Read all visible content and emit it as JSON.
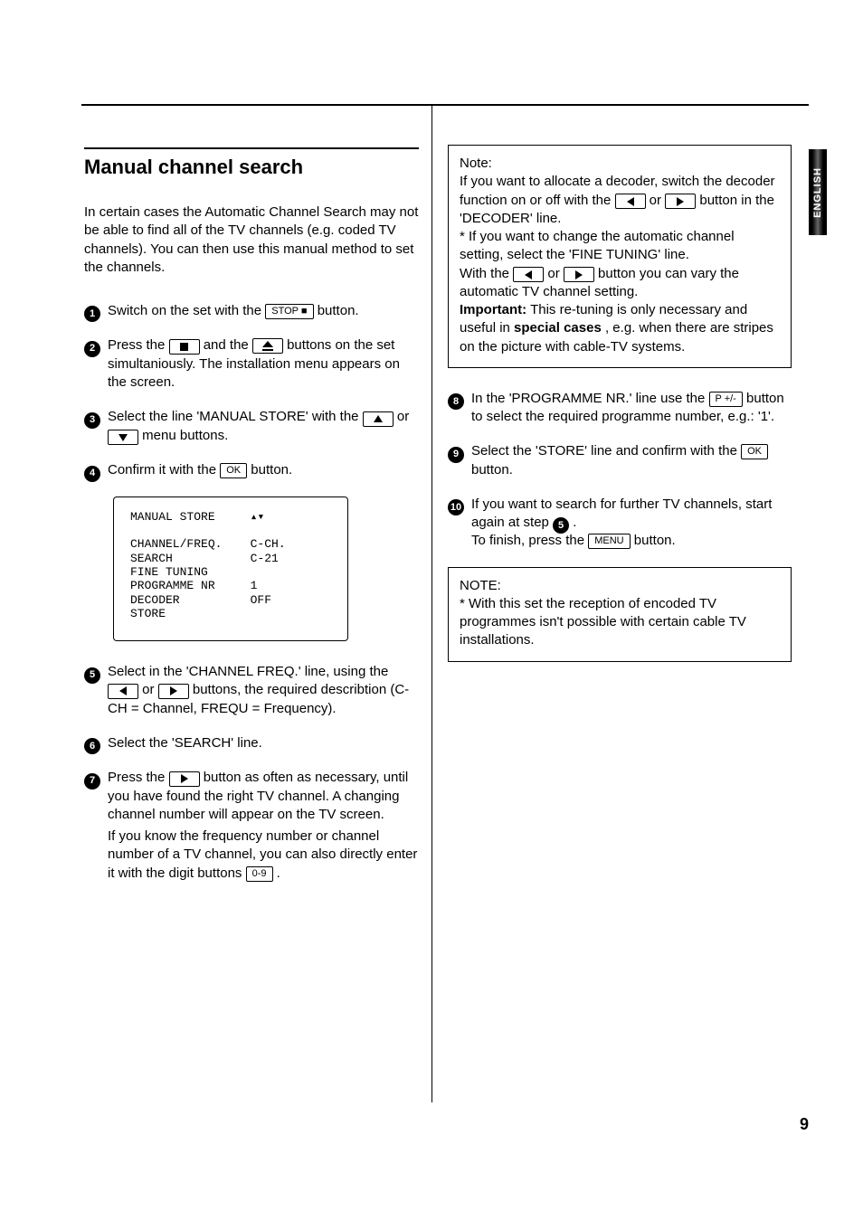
{
  "title": "Manual  channel search",
  "intro": "In certain cases the Automatic Channel Search may not be able to find all of the TV channels (e.g. coded TV channels). You can then use this manual method to set the channels.",
  "steps": {
    "s1a": "Switch on the set with the ",
    "s1b": " button.",
    "s2a": "Press the ",
    "s2b": " and the ",
    "s2c": " buttons on the set simultaniously. The installation menu appears on the screen.",
    "s3a": "Select the line 'MANUAL STORE' with the ",
    "s3b": " or ",
    "s3c": " menu buttons.",
    "s4a": "Confirm it with the ",
    "s4b": " button.",
    "s5a": "Select in the 'CHANNEL FREQ.' line, using the ",
    "s5b": " or ",
    "s5c": " buttons, the required describtion (C-CH = Channel, FREQU = Frequency).",
    "s6": "Select the 'SEARCH' line.",
    "s7a": "Press the ",
    "s7b": " button as often as necessary, until you have found the right TV channel. A changing channel number will appear on the TV screen.",
    "s7c": "If you know the frequency number or channel number of a TV channel, you can also directly enter it with the digit buttons ",
    "s7d": " .",
    "s8a": "In the 'PROGRAMME NR.' line use the ",
    "s8b": " button to select the required programme number, e.g.: '1'.",
    "s9a": "Select the 'STORE' line and confirm with the ",
    "s9b": " button.",
    "s10a": "If you want to search for further TV channels, start again at step ",
    "s10b": ".",
    "s10c": "To finish, press the ",
    "s10d": " button."
  },
  "buttons": {
    "stop": "STOP",
    "ok": "OK",
    "digits": "0-9",
    "pplusminus": "P +/-",
    "menu": "MENU"
  },
  "screen": "MANUAL STORE     ▴▾\n\nCHANNEL/FREQ.    C-CH.\nSEARCH           C-21\nFINE TUNING\nPROGRAMME NR     1\nDECODER          OFF\nSTORE",
  "note1": {
    "title": "Note:",
    "a": "If you want to allocate a decoder, switch the decoder function on or off with the ",
    "b": " or ",
    "c": " button in the 'DECODER' line.",
    "d": "* If you want to change the automatic channel setting, select the 'FINE TUNING' line.",
    "e": "With the ",
    "f": " or ",
    "g": " button you can vary the automatic TV channel setting.",
    "h1": "Important:",
    "h2": "  This re-tuning is only necessary and useful in ",
    "h3": "special cases",
    "h4": ", e.g. when there are stripes on the picture with cable-TV systems."
  },
  "note2": {
    "title": "NOTE:",
    "body": "* With this set the reception of encoded TV programmes isn't possible with certain cable TV installations."
  },
  "sidetab": "ENGLISH",
  "pagenum": "9"
}
